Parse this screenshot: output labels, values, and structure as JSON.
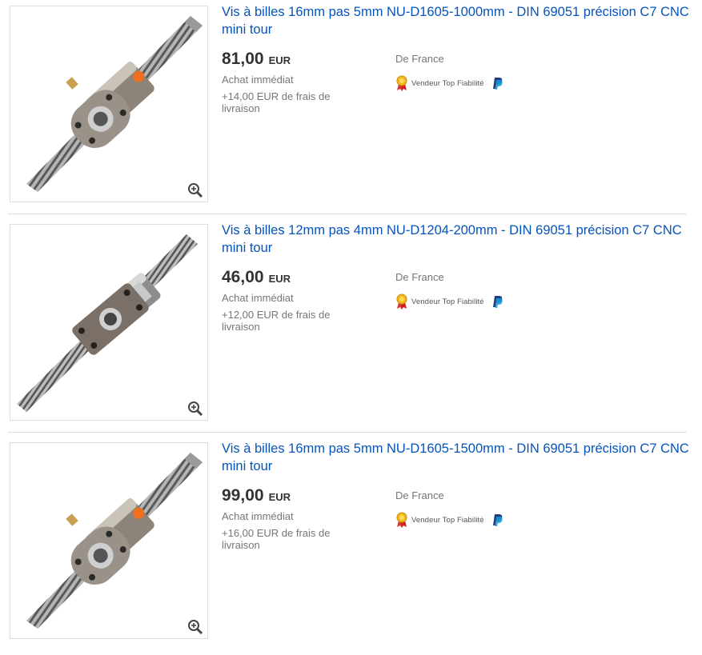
{
  "listings": [
    {
      "title": "Vis à billes 16mm pas 5mm NU-D1605-1000mm - DIN 69051 précision C7 CNC mini tour",
      "price": "81,00",
      "currency": "EUR",
      "format": "Achat immédiat",
      "shipping": "+14,00 EUR de frais de livraison",
      "origin": "De France",
      "seller_badge": "Vendeur Top Fiabilité",
      "image_icon": "zoom-icon"
    },
    {
      "title": "Vis à billes 12mm pas 4mm NU-D1204-200mm - DIN 69051 précision C7 CNC mini tour",
      "price": "46,00",
      "currency": "EUR",
      "format": "Achat immédiat",
      "shipping": "+12,00 EUR de frais de livraison",
      "origin": "De France",
      "seller_badge": "Vendeur Top Fiabilité",
      "image_icon": "zoom-icon"
    },
    {
      "title": "Vis à billes 16mm pas 5mm NU-D1605-1500mm - DIN 69051 précision C7 CNC mini tour",
      "price": "99,00",
      "currency": "EUR",
      "format": "Achat immédiat",
      "shipping": "+16,00 EUR de frais de livraison",
      "origin": "De France",
      "seller_badge": "Vendeur Top Fiabilité",
      "image_icon": "zoom-icon"
    }
  ],
  "colors": {
    "link": "#0654ba",
    "text": "#333333",
    "muted": "#767676",
    "nut_accent": "#f07020",
    "paypal_dark": "#253b80",
    "paypal_light": "#179bd7"
  }
}
